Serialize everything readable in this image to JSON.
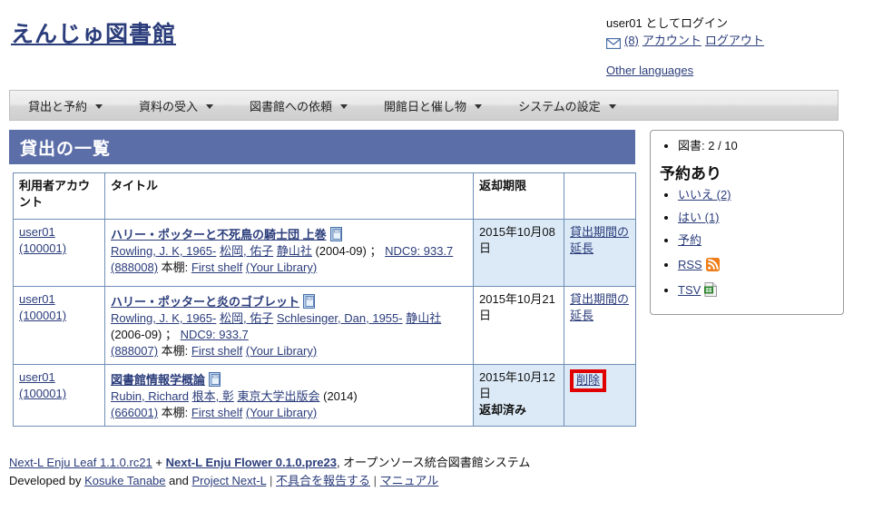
{
  "header": {
    "site_title": "えんじゅ図書館",
    "login_text": "user01 としてログイン",
    "mail_icon": "envelope-icon",
    "message_count": "(8)",
    "account_link": "アカウント",
    "logout_link": "ログアウト",
    "other_languages": "Other languages"
  },
  "menu": {
    "items": [
      {
        "label": "貸出と予約"
      },
      {
        "label": "資料の受入"
      },
      {
        "label": "図書館への依頼"
      },
      {
        "label": "開館日と催し物"
      },
      {
        "label": "システムの設定"
      }
    ]
  },
  "main": {
    "panel_title": "貸出の一覧",
    "columns": [
      "利用者アカウント",
      "タイトル",
      "返却期限",
      ""
    ],
    "rows": [
      {
        "account_user": "user01",
        "account_id": "(100001)",
        "title": "ハリー・ポッターと不死鳥の騎士団 上巻",
        "author": "Rowling, J. K, 1965-",
        "translator": "松岡, 佑子",
        "publisher": "静山社",
        "pubdate": "(2004-09)",
        "separator": "；",
        "classification": "NDC9: 933.7",
        "item_id": "(888008)",
        "shelf_label": "本棚:",
        "shelf": "First shelf",
        "library": "(Your Library)",
        "due_date": "2015年10月08日",
        "returned": "",
        "action": "貸出期間の延長",
        "action_highlight": false
      },
      {
        "account_user": "user01",
        "account_id": "(100001)",
        "title": "ハリー・ポッターと炎のゴブレット",
        "author": "Rowling, J. K, 1965-",
        "translator": "松岡, 佑子",
        "translator2": "Schlesinger, Dan, 1955-",
        "publisher": "静山社",
        "pubdate": "(2006-09)",
        "separator": "；",
        "classification": "NDC9: 933.7",
        "item_id": "(888007)",
        "shelf_label": "本棚:",
        "shelf": "First shelf",
        "library": "(Your Library)",
        "due_date": "2015年10月21日",
        "returned": "",
        "action": "貸出期間の延長",
        "action_highlight": false
      },
      {
        "account_user": "user01",
        "account_id": "(100001)",
        "title": "図書館情報学概論",
        "author": "Rubin, Richard",
        "translator": "根本, 彰",
        "publisher": "東京大学出版会",
        "pubdate": "(2014)",
        "item_id": "(666001)",
        "shelf_label": "本棚:",
        "shelf": "First shelf",
        "library": "(Your Library)",
        "due_date": "2015年10月12日",
        "returned": "返却済み",
        "action": "削除",
        "action_highlight": true
      }
    ]
  },
  "sidebar": {
    "stat": "図書: 2 / 10",
    "heading": "予約あり",
    "items": [
      {
        "label": "いいえ (2)",
        "icon": ""
      },
      {
        "label": "はい (1)",
        "icon": ""
      },
      {
        "label": "予約",
        "icon": ""
      },
      {
        "label": "RSS",
        "icon": "rss-icon"
      },
      {
        "label": "TSV",
        "icon": "spreadsheet-icon"
      }
    ]
  },
  "footer": {
    "leaf": "Next-L Enju Leaf 1.1.0.rc21",
    "plus": "+",
    "flower": "Next-L Enju Flower 0.1.0.pre23",
    "tagline": ", オープンソース統合図書館システム",
    "developed_by": "Developed by",
    "dev1": "Kosuke Tanabe",
    "and": "and",
    "dev2": "Project Next-L",
    "report": "不具合を報告する",
    "manual": "マニュアル"
  },
  "colors": {
    "panel_blue": "#5b6ea8",
    "row_blue": "#dceaf7",
    "link": "#2b3d7b",
    "highlight_red": "#e00000",
    "rss_orange": "#ef7c17",
    "tsv_green": "#3f9a3f"
  }
}
